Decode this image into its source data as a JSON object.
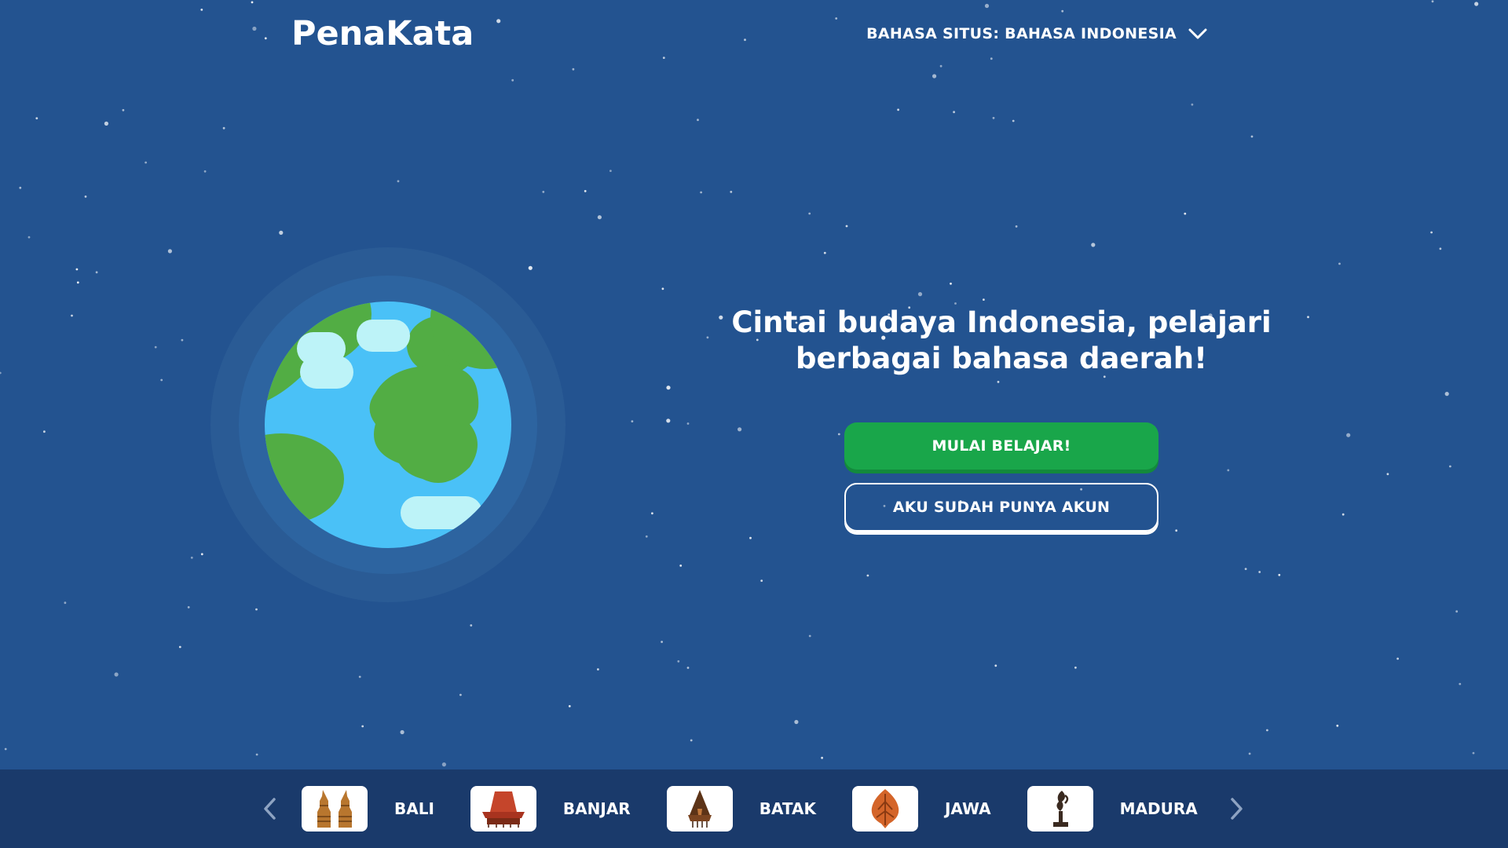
{
  "brand": {
    "logo_text": "PenaKata"
  },
  "header": {
    "language_selector_label": "BAHASA SITUS: BAHASA INDONESIA"
  },
  "hero": {
    "headline_line1": "Cintai budaya Indonesia, pelajari",
    "headline_line2": "berbagai bahasa daerah!",
    "primary_button": "MULAI BELAJAR!",
    "secondary_button": "AKU SUDAH PUNYA AKUN"
  },
  "footer": {
    "languages": [
      {
        "label": "BALI",
        "icon": "bali-gate-icon"
      },
      {
        "label": "BANJAR",
        "icon": "banjar-house-icon"
      },
      {
        "label": "BATAK",
        "icon": "batak-house-icon"
      },
      {
        "label": "JAWA",
        "icon": "gunungan-icon"
      },
      {
        "label": "MADURA",
        "icon": "madura-monument-icon"
      }
    ]
  },
  "colors": {
    "background": "#235390",
    "footer": "#1a3a6b",
    "primary_button": "#19a64a",
    "ocean": "#4ac1f7",
    "land": "#52ad44",
    "cloud": "#bdf3f8"
  }
}
